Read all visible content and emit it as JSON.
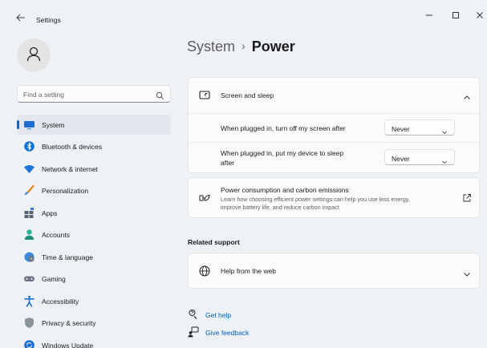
{
  "window": {
    "title": "Settings"
  },
  "search": {
    "placeholder": "Find a setting"
  },
  "sidebar": {
    "items": [
      {
        "label": "System",
        "icon": "monitor-icon",
        "active": true
      },
      {
        "label": "Bluetooth & devices",
        "icon": "bluetooth-icon"
      },
      {
        "label": "Network & internet",
        "icon": "wifi-icon"
      },
      {
        "label": "Personalization",
        "icon": "brush-icon"
      },
      {
        "label": "Apps",
        "icon": "apps-icon"
      },
      {
        "label": "Accounts",
        "icon": "person-icon"
      },
      {
        "label": "Time & language",
        "icon": "globe-clock-icon"
      },
      {
        "label": "Gaming",
        "icon": "gamepad-icon"
      },
      {
        "label": "Accessibility",
        "icon": "accessibility-icon"
      },
      {
        "label": "Privacy & security",
        "icon": "shield-icon"
      },
      {
        "label": "Windows Update",
        "icon": "update-icon"
      }
    ]
  },
  "breadcrumb": {
    "parent": "System",
    "separator": "›",
    "current": "Power"
  },
  "screen_sleep": {
    "title": "Screen and sleep",
    "expanded": true,
    "settings": [
      {
        "label": "When plugged in, turn off my screen after",
        "value": "Never"
      },
      {
        "label_line1": "When plugged in, put my device to sleep",
        "label_line2": "after",
        "value": "Never"
      }
    ]
  },
  "power_carbon": {
    "title": "Power consumption and carbon emissions",
    "desc_line1": "Learn how choosing efficient power settings can help you use less energy,",
    "desc_line2": "improve battery life, and reduce carbon impact"
  },
  "related_support": {
    "heading": "Related support",
    "help_title": "Help from the web"
  },
  "links": {
    "get_help": "Get help",
    "give_feedback": "Give feedback"
  },
  "colors": {
    "accent": "#0067c0",
    "link": "#005fb8",
    "window_bg": "#eef1f6",
    "card_bg": "#fbfbfb"
  }
}
